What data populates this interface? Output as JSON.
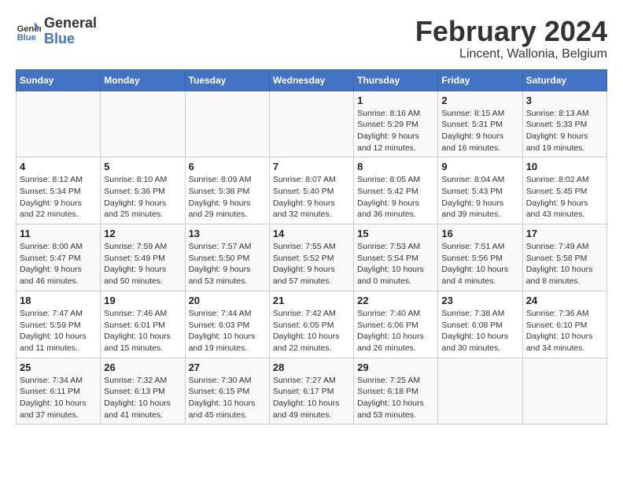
{
  "header": {
    "logo_general": "General",
    "logo_blue": "Blue",
    "month_title": "February 2024",
    "location": "Lincent, Wallonia, Belgium"
  },
  "weekdays": [
    "Sunday",
    "Monday",
    "Tuesday",
    "Wednesday",
    "Thursday",
    "Friday",
    "Saturday"
  ],
  "weeks": [
    [
      {
        "day": "",
        "info": ""
      },
      {
        "day": "",
        "info": ""
      },
      {
        "day": "",
        "info": ""
      },
      {
        "day": "",
        "info": ""
      },
      {
        "day": "1",
        "info": "Sunrise: 8:16 AM\nSunset: 5:29 PM\nDaylight: 9 hours\nand 12 minutes."
      },
      {
        "day": "2",
        "info": "Sunrise: 8:15 AM\nSunset: 5:31 PM\nDaylight: 9 hours\nand 16 minutes."
      },
      {
        "day": "3",
        "info": "Sunrise: 8:13 AM\nSunset: 5:33 PM\nDaylight: 9 hours\nand 19 minutes."
      }
    ],
    [
      {
        "day": "4",
        "info": "Sunrise: 8:12 AM\nSunset: 5:34 PM\nDaylight: 9 hours\nand 22 minutes."
      },
      {
        "day": "5",
        "info": "Sunrise: 8:10 AM\nSunset: 5:36 PM\nDaylight: 9 hours\nand 25 minutes."
      },
      {
        "day": "6",
        "info": "Sunrise: 8:09 AM\nSunset: 5:38 PM\nDaylight: 9 hours\nand 29 minutes."
      },
      {
        "day": "7",
        "info": "Sunrise: 8:07 AM\nSunset: 5:40 PM\nDaylight: 9 hours\nand 32 minutes."
      },
      {
        "day": "8",
        "info": "Sunrise: 8:05 AM\nSunset: 5:42 PM\nDaylight: 9 hours\nand 36 minutes."
      },
      {
        "day": "9",
        "info": "Sunrise: 8:04 AM\nSunset: 5:43 PM\nDaylight: 9 hours\nand 39 minutes."
      },
      {
        "day": "10",
        "info": "Sunrise: 8:02 AM\nSunset: 5:45 PM\nDaylight: 9 hours\nand 43 minutes."
      }
    ],
    [
      {
        "day": "11",
        "info": "Sunrise: 8:00 AM\nSunset: 5:47 PM\nDaylight: 9 hours\nand 46 minutes."
      },
      {
        "day": "12",
        "info": "Sunrise: 7:59 AM\nSunset: 5:49 PM\nDaylight: 9 hours\nand 50 minutes."
      },
      {
        "day": "13",
        "info": "Sunrise: 7:57 AM\nSunset: 5:50 PM\nDaylight: 9 hours\nand 53 minutes."
      },
      {
        "day": "14",
        "info": "Sunrise: 7:55 AM\nSunset: 5:52 PM\nDaylight: 9 hours\nand 57 minutes."
      },
      {
        "day": "15",
        "info": "Sunrise: 7:53 AM\nSunset: 5:54 PM\nDaylight: 10 hours\nand 0 minutes."
      },
      {
        "day": "16",
        "info": "Sunrise: 7:51 AM\nSunset: 5:56 PM\nDaylight: 10 hours\nand 4 minutes."
      },
      {
        "day": "17",
        "info": "Sunrise: 7:49 AM\nSunset: 5:58 PM\nDaylight: 10 hours\nand 8 minutes."
      }
    ],
    [
      {
        "day": "18",
        "info": "Sunrise: 7:47 AM\nSunset: 5:59 PM\nDaylight: 10 hours\nand 11 minutes."
      },
      {
        "day": "19",
        "info": "Sunrise: 7:46 AM\nSunset: 6:01 PM\nDaylight: 10 hours\nand 15 minutes."
      },
      {
        "day": "20",
        "info": "Sunrise: 7:44 AM\nSunset: 6:03 PM\nDaylight: 10 hours\nand 19 minutes."
      },
      {
        "day": "21",
        "info": "Sunrise: 7:42 AM\nSunset: 6:05 PM\nDaylight: 10 hours\nand 22 minutes."
      },
      {
        "day": "22",
        "info": "Sunrise: 7:40 AM\nSunset: 6:06 PM\nDaylight: 10 hours\nand 26 minutes."
      },
      {
        "day": "23",
        "info": "Sunrise: 7:38 AM\nSunset: 6:08 PM\nDaylight: 10 hours\nand 30 minutes."
      },
      {
        "day": "24",
        "info": "Sunrise: 7:36 AM\nSunset: 6:10 PM\nDaylight: 10 hours\nand 34 minutes."
      }
    ],
    [
      {
        "day": "25",
        "info": "Sunrise: 7:34 AM\nSunset: 6:11 PM\nDaylight: 10 hours\nand 37 minutes."
      },
      {
        "day": "26",
        "info": "Sunrise: 7:32 AM\nSunset: 6:13 PM\nDaylight: 10 hours\nand 41 minutes."
      },
      {
        "day": "27",
        "info": "Sunrise: 7:30 AM\nSunset: 6:15 PM\nDaylight: 10 hours\nand 45 minutes."
      },
      {
        "day": "28",
        "info": "Sunrise: 7:27 AM\nSunset: 6:17 PM\nDaylight: 10 hours\nand 49 minutes."
      },
      {
        "day": "29",
        "info": "Sunrise: 7:25 AM\nSunset: 6:18 PM\nDaylight: 10 hours\nand 53 minutes."
      },
      {
        "day": "",
        "info": ""
      },
      {
        "day": "",
        "info": ""
      }
    ]
  ]
}
